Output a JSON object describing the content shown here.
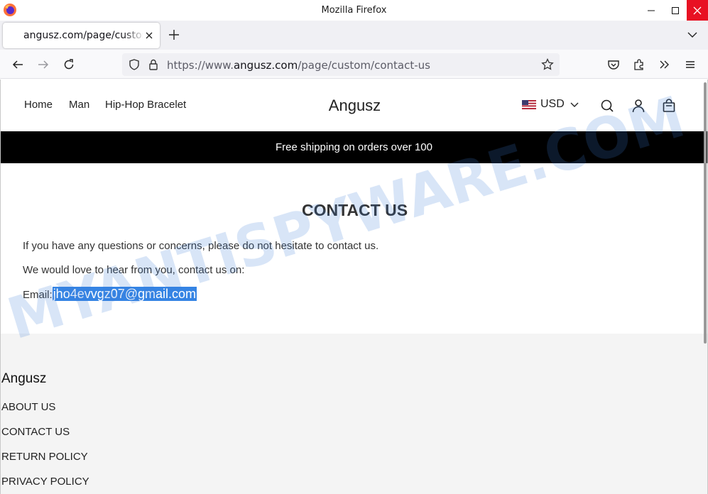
{
  "window": {
    "title": "Mozilla Firefox"
  },
  "tabs": [
    {
      "label": "angusz.com/page/custom/contact-us"
    }
  ],
  "urlbar": {
    "prefix": "https://www.",
    "host": "angusz.com",
    "path": "/page/custom/contact-us"
  },
  "site": {
    "nav": [
      "Home",
      "Man",
      "Hip-Hop Bracelet"
    ],
    "brand": "Angusz",
    "currency": "USD",
    "banner": "Free shipping on orders over 100"
  },
  "content": {
    "heading": "CONTACT US",
    "line1": "If you have any questions or concerns, please do not hesitate to contact us.",
    "line2": "We would love to hear from you, contact us on:",
    "email_label": "Email:",
    "email": "jho4evvgz07@gmail.com"
  },
  "footer": {
    "brand": "Angusz",
    "links": [
      "ABOUT US",
      "CONTACT US",
      "RETURN POLICY",
      "PRIVACY POLICY"
    ]
  },
  "watermark": "MYANTISPYWARE.COM",
  "colors": {
    "accent": "#3584e4",
    "banner_bg": "#000000",
    "close": "#e81123",
    "watermark": "#3a7bd5"
  }
}
